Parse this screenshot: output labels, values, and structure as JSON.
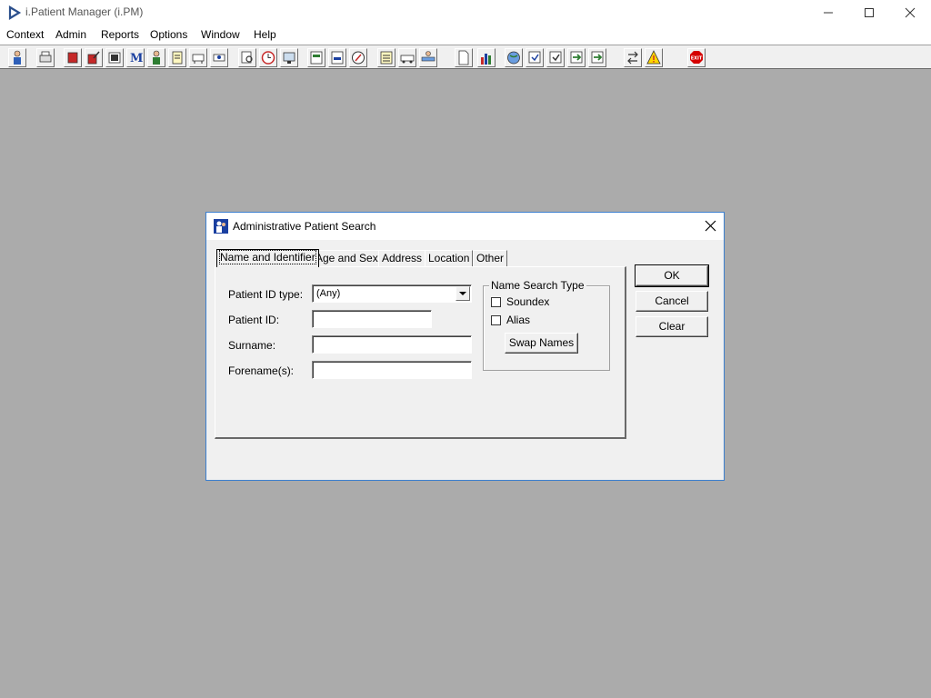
{
  "app": {
    "title": "i.Patient Manager (i.PM)"
  },
  "menu": [
    "Context",
    "Admin",
    "Reports",
    "Options",
    "Window",
    "Help"
  ],
  "toolbar": {
    "icons": [
      "person-icon",
      "printer-icon",
      "book-icon",
      "edit-icon",
      "scan-icon",
      "letter-m-icon",
      "doctor-icon",
      "notes-icon",
      "referral-icon",
      "referral-2-icon",
      "search-doc-icon",
      "clock-icon",
      "monitor-icon",
      "chart-card-icon",
      "chart-card-2-icon",
      "compass-icon",
      "list-icon",
      "ambulance-icon",
      "bed-icon",
      "document-icon",
      "bar-chart-icon",
      "globe-icon",
      "check-doc-icon",
      "check-doc-2-icon",
      "transfer-icon",
      "transfer-2-icon",
      "swap-icon",
      "warning-icon",
      "exit-icon"
    ],
    "exit_label": "EXIT"
  },
  "dialog": {
    "title": "Administrative Patient Search",
    "tabs": [
      "Name and Identifier",
      "Age and Sex",
      "Address",
      "Location",
      "Other"
    ],
    "labels": {
      "patient_id_type": "Patient ID type:",
      "patient_id": "Patient ID:",
      "surname": "Surname:",
      "forenames": "Forename(s):"
    },
    "patient_id_type_value": "(Any)",
    "patient_id_value": "",
    "surname_value": "",
    "forenames_value": "",
    "name_search_type": {
      "legend": "Name Search Type",
      "soundex": "Soundex",
      "alias": "Alias",
      "swap_names": "Swap Names"
    },
    "buttons": {
      "ok": "OK",
      "cancel": "Cancel",
      "clear": "Clear"
    }
  }
}
